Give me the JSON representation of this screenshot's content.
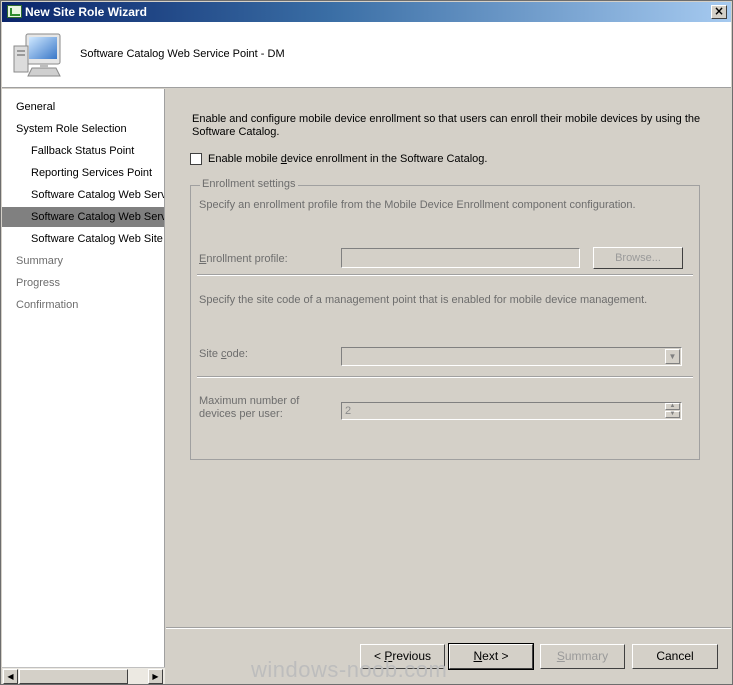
{
  "window": {
    "title": "New Site Role Wizard",
    "close_label": "×"
  },
  "header": {
    "title": "Software Catalog Web Service Point - DM"
  },
  "nav": {
    "items": [
      {
        "label": "General",
        "state": "normal"
      },
      {
        "label": "System Role Selection",
        "state": "normal"
      },
      {
        "label": "Fallback Status Point",
        "state": "normal"
      },
      {
        "label": "Reporting Services Point",
        "state": "normal"
      },
      {
        "label": "Software Catalog Web Service Point",
        "state": "normal"
      },
      {
        "label": "Software Catalog Web Service Point",
        "state": "active"
      },
      {
        "label": "Software Catalog Web Site Point",
        "state": "normal"
      },
      {
        "label": "Summary",
        "state": "gray"
      },
      {
        "label": "Progress",
        "state": "gray"
      },
      {
        "label": "Confirmation",
        "state": "gray"
      }
    ]
  },
  "main": {
    "description": "Enable and configure mobile device enrollment so that users can enroll their mobile devices by using the Software Catalog.",
    "enable_checkbox": {
      "label_pre": "Enable mobile ",
      "label_accel": "d",
      "label_post": "evice enrollment in the Software Catalog.",
      "checked": false
    },
    "group": {
      "legend": "Enrollment settings",
      "profile_hint": "Specify an enrollment profile from the Mobile Device Enrollment component configuration.",
      "profile_label_accel": "E",
      "profile_label_rest": "nrollment profile:",
      "profile_value": "",
      "browse_label": "Browse...",
      "site_hint": "Specify the site code of a management point that is enabled for mobile device management.",
      "site_label_pre": "Site ",
      "site_label_accel": "c",
      "site_label_post": "ode:",
      "site_value": "",
      "max_label_line1": "Maximum number of",
      "max_label_line2": "devices per user:",
      "max_value": "2"
    }
  },
  "footer": {
    "previous": {
      "pre": "< ",
      "accel": "P",
      "rest": "revious"
    },
    "next": {
      "accel": "N",
      "rest": "ext >"
    },
    "summary": {
      "accel": "S",
      "rest": "ummary"
    },
    "cancel": "Cancel"
  },
  "watermark": "windows-noob.com",
  "colors": {
    "title_bar_start": "#0a246a",
    "title_bar_end": "#a6caf0",
    "dialog_face": "#d4d0c8",
    "nav_selected": "#808080",
    "disabled_text": "#6d6d6d"
  }
}
